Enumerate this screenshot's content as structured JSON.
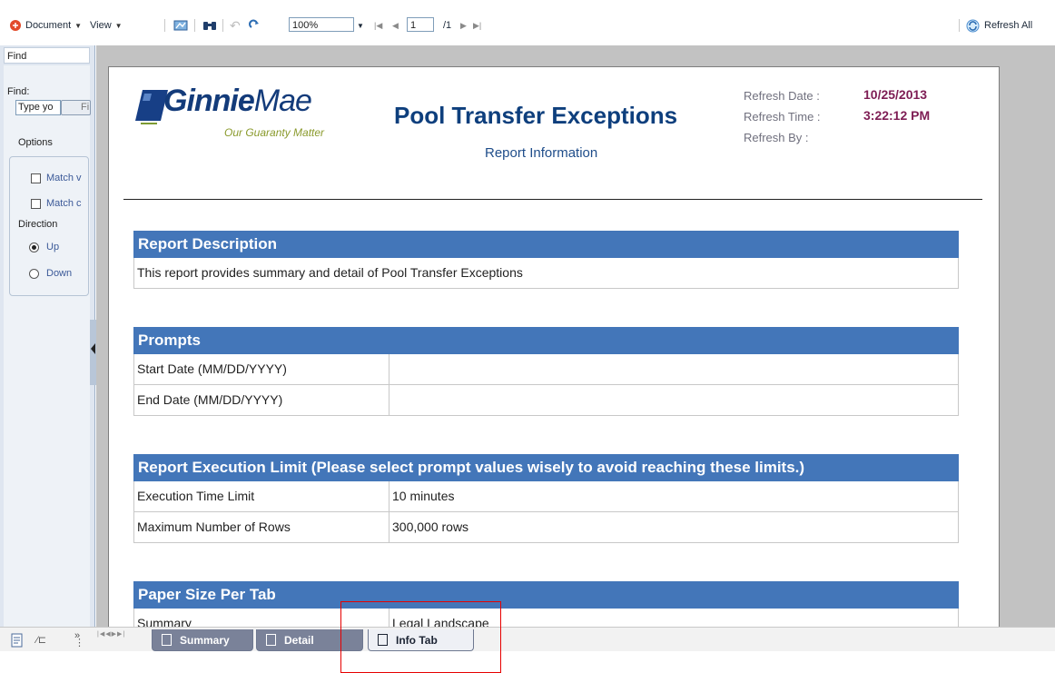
{
  "toolbar": {
    "document_label": "Document",
    "view_label": "View",
    "zoom_value": "100%",
    "page_current": "1",
    "page_total": "/1",
    "refresh_all_label": "Refresh All"
  },
  "find_panel": {
    "header": "Find",
    "find_label": "Find:",
    "input_value": "Type yo",
    "find_button_label": "Fi",
    "options_label": "Options",
    "match_whole_label": "Match v",
    "match_case_label": "Match c",
    "direction_label": "Direction",
    "up_label": "Up",
    "down_label": "Down"
  },
  "report": {
    "logo_name_bold": "Ginnie",
    "logo_name_light": "Mae",
    "logo_tagline": "Our Guaranty Matter",
    "title": "Pool Transfer Exceptions",
    "subtitle": "Report Information",
    "refresh_date_label": "Refresh Date :",
    "refresh_date_value": "10/25/2013",
    "refresh_time_label": "Refresh Time :",
    "refresh_time_value": "3:22:12 PM",
    "refresh_by_label": "Refresh By :",
    "description_header": "Report Description",
    "description_text": "This report provides summary and detail of Pool Transfer Exceptions",
    "prompts_header": "Prompts",
    "prompts": [
      {
        "label": "Start Date  (MM/DD/YYYY)",
        "value": ""
      },
      {
        "label": "End Date  (MM/DD/YYYY)",
        "value": ""
      }
    ],
    "limit_header": "Report Execution Limit (Please select prompt values wisely to avoid reaching these limits.)",
    "limits": [
      {
        "label": "Execution Time Limit",
        "value": "10 minutes"
      },
      {
        "label": "Maximum Number of Rows",
        "value": "300,000 rows"
      }
    ],
    "paper_header": "Paper Size Per Tab",
    "paper_rows": [
      {
        "label": "Summary",
        "value": "Legal Landscape"
      }
    ]
  },
  "tabs": [
    {
      "label": "Summary",
      "active": false
    },
    {
      "label": "Detail",
      "active": false
    },
    {
      "label": "Info Tab",
      "active": true
    }
  ],
  "colors": {
    "header_blue": "#4376b9",
    "title_blue": "#0e3f7d",
    "refresh_value": "#7e1d54",
    "highlight_red": "#e60000"
  }
}
